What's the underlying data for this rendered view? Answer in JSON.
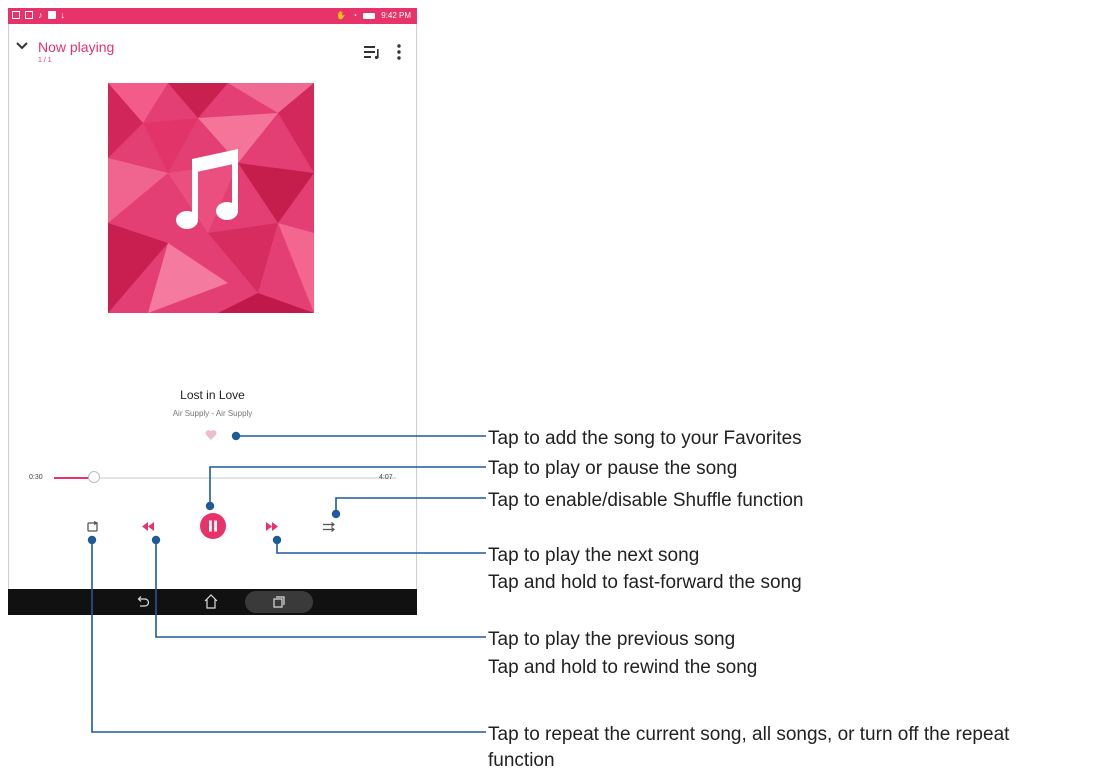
{
  "status_bar": {
    "time": "9:42 PM"
  },
  "header": {
    "title": "Now playing",
    "track_position": "1 / 1"
  },
  "song": {
    "title": "Lost in Love",
    "artist": "Air Supply - Air Supply"
  },
  "player": {
    "current_time": "0:30",
    "total_time": "4:07",
    "progress_fraction": 0.121,
    "state": "playing"
  },
  "colors": {
    "accent": "#e8336a",
    "leader_line": "#1f5a9c",
    "navbar": "#111111"
  },
  "icons": {
    "collapse": "chevron-down-icon",
    "queue": "queue-music-icon",
    "overflow": "more-vert-icon",
    "favorite": "heart-icon",
    "repeat": "repeat-icon",
    "previous": "rewind-icon",
    "play_pause": "pause-icon",
    "next": "fast-forward-icon",
    "shuffle": "shuffle-icon",
    "nav_back": "back-icon",
    "nav_home": "home-icon",
    "nav_recents": "recents-icon"
  },
  "callouts": {
    "favorites": "Tap to add the song to your Favorites",
    "play_pause": "Tap to play or pause the song",
    "shuffle": "Tap to enable/disable Shuffle function",
    "next_line1": "Tap to play the next song",
    "next_line2": "Tap and hold to fast-forward the song",
    "previous_line1": "Tap to play the previous song",
    "previous_line2": "Tap and hold to rewind the song",
    "repeat_line1": "Tap to repeat the current song, all songs, or turn off the repeat",
    "repeat_line2": "function"
  }
}
